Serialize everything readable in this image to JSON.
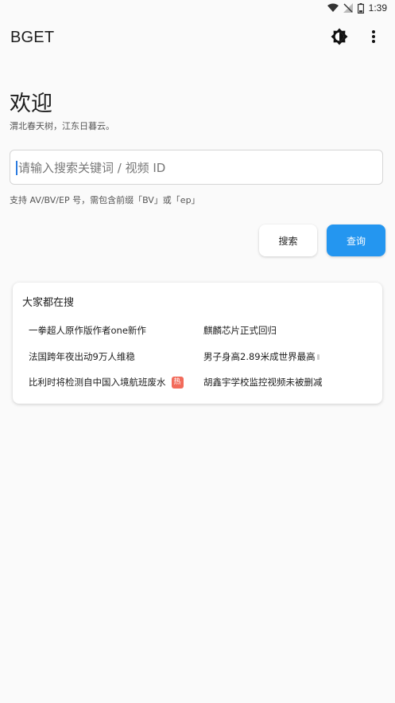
{
  "status_bar": {
    "time": "1:39"
  },
  "app_bar": {
    "title": "BGET",
    "theme_icon": "brightness-icon",
    "more_icon": "more-vert-icon"
  },
  "welcome": {
    "title": "欢迎",
    "subtitle": "渭北春天树，江东日暮云。"
  },
  "search": {
    "placeholder": "请输入搜索关键词 / 视频 ID",
    "value": "",
    "helper": "支持 AV/BV/EP 号，需包含前缀「BV」或「ep」"
  },
  "actions": {
    "search_label": "搜索",
    "query_label": "查询"
  },
  "hot": {
    "title": "大家都在搜",
    "items": [
      {
        "text": "一拳超人原作版作者one新作",
        "badge": ""
      },
      {
        "text": "麒麟芯片正式回归",
        "badge": ""
      },
      {
        "text": "法国跨年夜出动9万人维稳",
        "badge": ""
      },
      {
        "text": "男子身高2.89米成世界最高",
        "badge": ""
      },
      {
        "text": "比利时将检测自中国入境航班废水",
        "badge": "热"
      },
      {
        "text": "胡鑫宇学校监控视频未被删减",
        "badge": ""
      }
    ]
  },
  "colors": {
    "accent": "#2496f0",
    "hot_badge": "#f26b5b",
    "background": "#fafafa"
  }
}
